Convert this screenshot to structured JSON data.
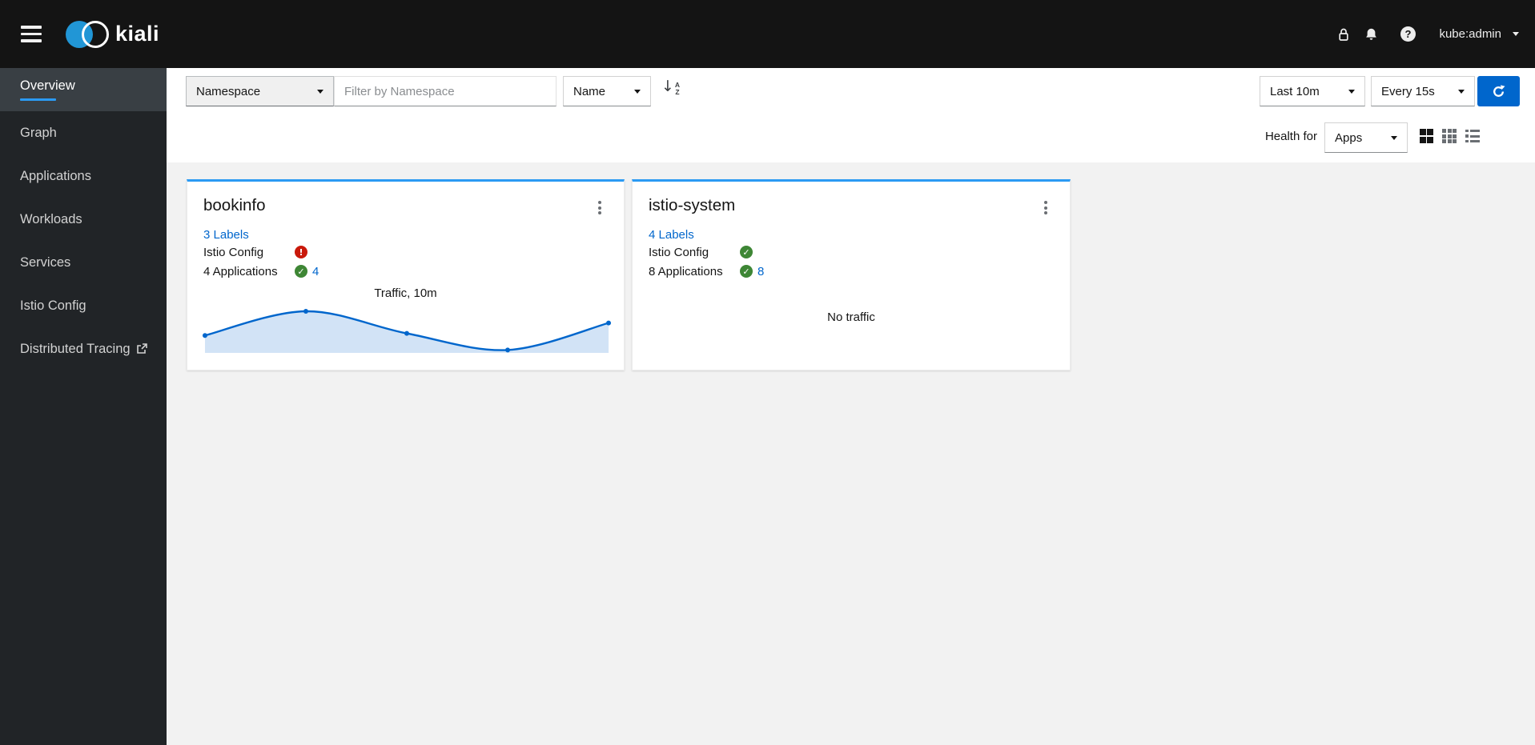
{
  "header": {
    "brand": "kiali",
    "username": "kube:admin"
  },
  "sidebar": {
    "active_item": "Overview",
    "items": [
      {
        "label": "Overview"
      },
      {
        "label": "Graph"
      },
      {
        "label": "Applications"
      },
      {
        "label": "Workloads"
      },
      {
        "label": "Services"
      },
      {
        "label": "Istio Config"
      },
      {
        "label": "Distributed Tracing",
        "external": true
      }
    ]
  },
  "toolbar": {
    "filter_type_value": "Namespace",
    "filter_placeholder": "Filter by Namespace",
    "sort_field_value": "Name",
    "duration_value": "Last 10m",
    "refresh_value": "Every 15s",
    "health_for_label": "Health for",
    "health_for_value": "Apps"
  },
  "namespaces": [
    {
      "name": "bookinfo",
      "labels_link": "3 Labels",
      "istio_config_label": "Istio Config",
      "istio_config_status": "error",
      "applications_label": "4 Applications",
      "applications_status": "healthy",
      "applications_count": "4",
      "traffic_title": "Traffic, 10m"
    },
    {
      "name": "istio-system",
      "labels_link": "4 Labels",
      "istio_config_label": "Istio Config",
      "istio_config_status": "healthy",
      "applications_label": "8 Applications",
      "applications_status": "healthy",
      "applications_count": "8",
      "no_traffic_text": "No traffic"
    }
  ],
  "chart_data": {
    "type": "area",
    "title": "Traffic, 10m",
    "xlabel": "time over last 10m (no axis labels shown)",
    "ylabel": "traffic (no axis labels shown)",
    "x_fraction": [
      0,
      0.25,
      0.5,
      0.75,
      1
    ],
    "values_normalized": [
      0.42,
      1.0,
      0.47,
      0.07,
      0.72
    ],
    "grid": false,
    "legend": false,
    "line_color": "#0066cc",
    "fill_color": "#d2e3f6"
  },
  "icons": {
    "help_glyph": "?",
    "error_glyph": "!",
    "success_glyph": "✓",
    "sort_arrow_glyph": "↓",
    "sort_letter_a": "A",
    "sort_letter_z": "Z"
  },
  "colors": {
    "accent_blue": "#2b9af3",
    "link_blue": "#0066cc",
    "danger_red": "#c9190b",
    "success_green": "#3e8635",
    "masthead_bg": "#141414",
    "sidebar_bg": "#212427",
    "content_bg": "#f2f2f2",
    "refresh_button_bg": "#0066cc"
  }
}
